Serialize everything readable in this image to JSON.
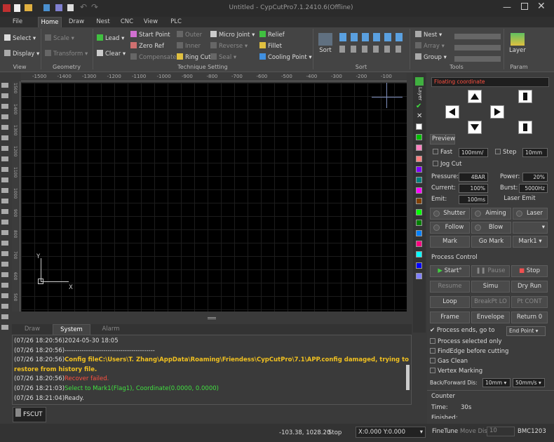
{
  "window": {
    "title": "Untitled - CypCutPro7.1.2410.6(Offline)"
  },
  "tabs": [
    "File",
    "Home",
    "Draw",
    "Nest",
    "CNC",
    "View",
    "PLC"
  ],
  "ribbon": {
    "select": "Select",
    "display": "Display",
    "scale": "Scale",
    "transform": "Transform",
    "lead": "Lead",
    "clear": "Clear",
    "start_point": "Start Point",
    "zero_ref": "Zero Ref",
    "compensate": "Compensate",
    "outer": "Outer",
    "inner": "Inner",
    "ring_cut": "Ring Cut",
    "micro_joint": "Micro Joint",
    "reverse": "Reverse",
    "seal": "Seal",
    "relief": "Relief",
    "fillet": "Fillet",
    "cooling_point": "Cooling Point",
    "sort": "Sort",
    "nest": "Nest",
    "array": "Array",
    "group": "Group",
    "layer": "Layer",
    "groups": {
      "view": "View",
      "geometry": "Geometry",
      "technique": "Technique Setting",
      "sort": "Sort",
      "tools": "Tools",
      "param": "Param"
    }
  },
  "rulers": {
    "top": [
      "-1500",
      "-1400",
      "-1300",
      "-1200",
      "-1100",
      "-1000",
      "-900",
      "-800",
      "-700",
      "-600",
      "-500",
      "-400",
      "-300",
      "-200",
      "-100"
    ],
    "left": [
      "1500",
      "1400",
      "1300",
      "1200",
      "1100",
      "1000",
      "900",
      "800",
      "700",
      "600",
      "500"
    ]
  },
  "canvas": {
    "axis_y": "Y",
    "axis_x": "X"
  },
  "layer_label": "Layer",
  "layer_colors": [
    "#ffffff",
    "#00c000",
    "#ff80c0",
    "#ff8080",
    "#8000ff",
    "#008080",
    "#ff00ff",
    "#804000",
    "#00ff00",
    "#008000",
    "#0080ff",
    "#ff0080",
    "#00ffff",
    "#0000ff",
    "#8080ff"
  ],
  "panel": {
    "coord_mode": "Floating coordinate",
    "preview": "Preview",
    "fast": "Fast",
    "fast_speed": "100mm/",
    "step": "Step",
    "step_val": "10mm",
    "jog_cut": "Jog Cut",
    "pressure": "Pressure:",
    "pressure_val": "4BAR",
    "power": "Power:",
    "power_val": "20%",
    "current": "Current:",
    "current_val": "100%",
    "burst": "Burst:",
    "burst_val": "5000Hz",
    "emit": "Emit:",
    "emit_val": "100ms",
    "laser_emit": "Laser Emit",
    "shutter": "Shutter",
    "aiming": "Aiming",
    "laser": "Laser",
    "follow": "Follow",
    "blow": "Blow",
    "mark": "Mark",
    "go_mark": "Go Mark",
    "mark1": "Mark1",
    "process_control": "Process Control",
    "start": "Start",
    "pause": "Pause",
    "stop": "Stop",
    "resume": "Resume",
    "simu": "Simu",
    "dry_run": "Dry Run",
    "loop": "Loop",
    "breakpt": "BreakPt LO",
    "pt_cont": "Pt CONT",
    "frame": "Frame",
    "envelope": "Envelope",
    "return0": "Return 0",
    "process_ends": "Process ends, go to",
    "end_point": "End Point",
    "process_selected": "Process selected only",
    "findedge": "FindEdge before cutting",
    "gas_clean": "Gas Clean",
    "vertex_marking": "Vertex Marking",
    "back_forward": "Back/Forward Dis:",
    "bf_dist": "10mm",
    "bf_speed": "50mm/s",
    "counter": "Counter",
    "time_label": "Time:",
    "time_val": "30s",
    "finished": "Finished:"
  },
  "bottom_tabs": [
    "Draw",
    "System",
    "Alarm"
  ],
  "log": [
    {
      "t": "(07/26 18:20:56)",
      "m": "2024-05-30 18:05",
      "c": "#dddddd"
    },
    {
      "t": "(07/26 18:20:56)",
      "m": "------------------------------------------",
      "c": "#dddddd"
    },
    {
      "t": "(07/26 18:20:56)",
      "m": "Config fileC:\\Users\\T. Zhang\\AppData\\Roaming\\Friendess\\CypCutPro\\7.1\\APP.config damaged, trying to",
      "c": "#f0c020"
    },
    {
      "t": "",
      "m": "restore from history file.",
      "c": "#f0c020"
    },
    {
      "t": "(07/26 18:20:56)",
      "m": "Recover failed.",
      "c": "#ff5040"
    },
    {
      "t": "(07/26 18:21:03)",
      "m": "Select to Mark1(Flag1), Coordinate(0.0000, 0.0000)",
      "c": "#40e040"
    },
    {
      "t": "(07/26 18:21:04)",
      "m": "Ready.",
      "c": "#dddddd"
    }
  ],
  "fscut": "FSCUT",
  "status": {
    "coords": "-103.38, 1028.20",
    "state": "Stop",
    "xy": "X:0.000 Y:0.000",
    "finetune": "FineTune",
    "move_dis": "Move Dis",
    "move_val": "10",
    "bmc": "BMC1203"
  }
}
